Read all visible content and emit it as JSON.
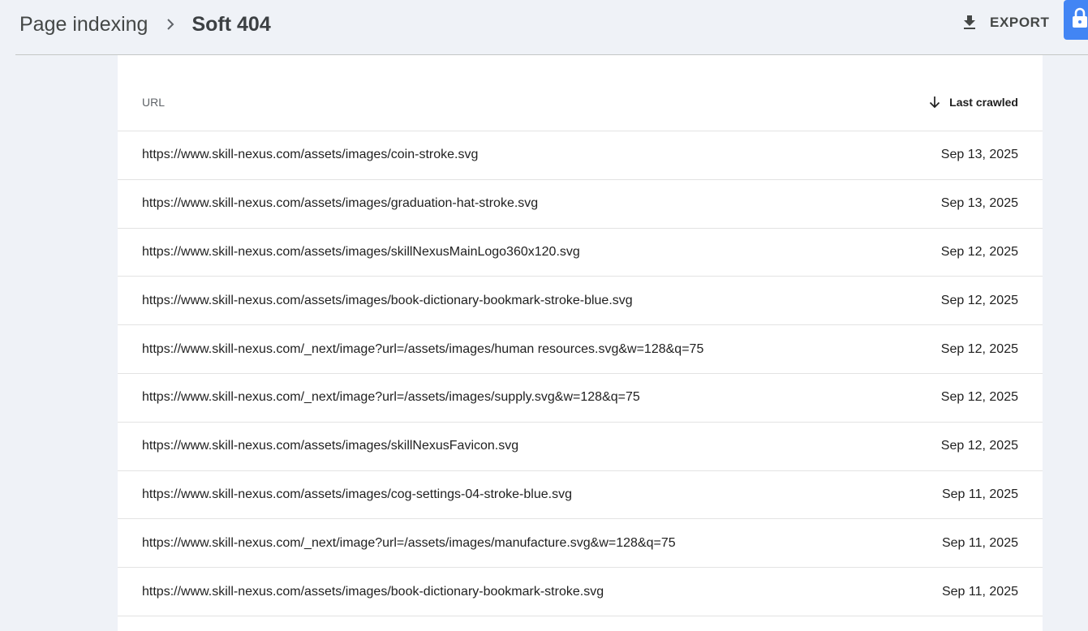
{
  "header": {
    "breadcrumb_parent": "Page indexing",
    "breadcrumb_current": "Soft 404",
    "export_label": "EXPORT"
  },
  "table": {
    "columns": {
      "url": "URL",
      "last_crawled": "Last crawled"
    },
    "sort": "Last crawled descending",
    "rows": [
      {
        "url": "https://www.skill-nexus.com/assets/images/coin-stroke.svg",
        "date": "Sep 13, 2025"
      },
      {
        "url": "https://www.skill-nexus.com/assets/images/graduation-hat-stroke.svg",
        "date": "Sep 13, 2025"
      },
      {
        "url": "https://www.skill-nexus.com/assets/images/skillNexusMainLogo360x120.svg",
        "date": "Sep 12, 2025"
      },
      {
        "url": "https://www.skill-nexus.com/assets/images/book-dictionary-bookmark-stroke-blue.svg",
        "date": "Sep 12, 2025"
      },
      {
        "url": "https://www.skill-nexus.com/_next/image?url=/assets/images/human resources.svg&w=128&q=75",
        "date": "Sep 12, 2025"
      },
      {
        "url": "https://www.skill-nexus.com/_next/image?url=/assets/images/supply.svg&w=128&q=75",
        "date": "Sep 12, 2025"
      },
      {
        "url": "https://www.skill-nexus.com/assets/images/skillNexusFavicon.svg",
        "date": "Sep 12, 2025"
      },
      {
        "url": "https://www.skill-nexus.com/assets/images/cog-settings-04-stroke-blue.svg",
        "date": "Sep 11, 2025"
      },
      {
        "url": "https://www.skill-nexus.com/_next/image?url=/assets/images/manufacture.svg&w=128&q=75",
        "date": "Sep 11, 2025"
      },
      {
        "url": "https://www.skill-nexus.com/assets/images/book-dictionary-bookmark-stroke.svg",
        "date": "Sep 11, 2025"
      }
    ]
  },
  "icons": {
    "breadcrumb_separator": "chevron-right-icon",
    "export": "download-icon",
    "sort": "arrow-down-icon",
    "lock": "lock-icon"
  },
  "colors": {
    "page_background": "#eff2f7",
    "accent": "#4285f4",
    "divider": "#e3e3e3"
  }
}
